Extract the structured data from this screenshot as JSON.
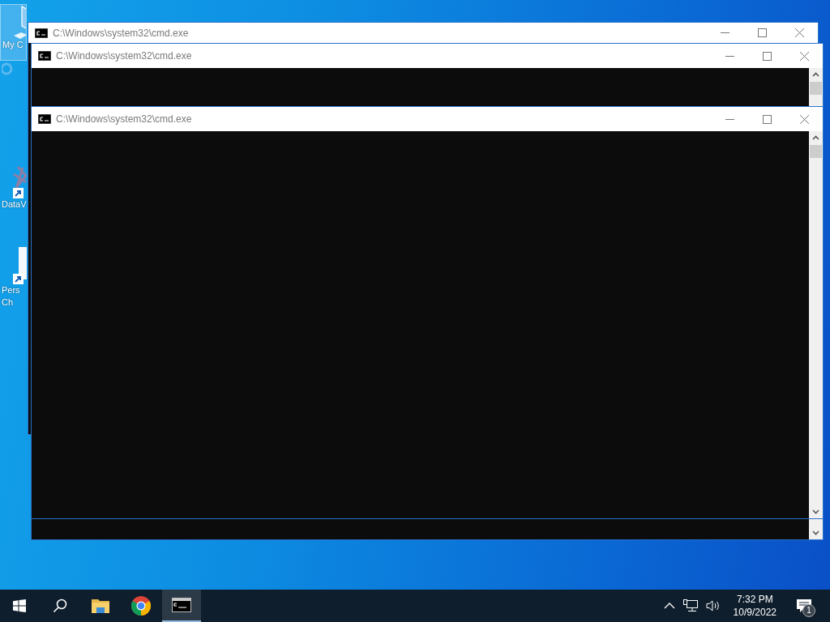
{
  "desktop_icons": [
    {
      "kind": "folder",
      "lines": [
        "My C"
      ],
      "selected": true
    },
    {
      "kind": "ring",
      "selected": false
    },
    {
      "kind": "chart",
      "lines": [
        "DataV"
      ],
      "selected": false
    },
    {
      "kind": "doc",
      "lines": [
        "Pers",
        "Ch"
      ],
      "selected": false
    }
  ],
  "windows": [
    {
      "title": "C:\\Windows\\system32\\cmd.exe"
    },
    {
      "title": "C:\\Windows\\system32\\cmd.exe"
    },
    {
      "title": "C:\\Windows\\system32\\cmd.exe"
    }
  ],
  "taskbar": {
    "apps": [
      {
        "kind": "start",
        "selected": false
      },
      {
        "kind": "search",
        "selected": false
      },
      {
        "kind": "explorer",
        "selected": false
      },
      {
        "kind": "chrome",
        "selected": false
      },
      {
        "kind": "cmd",
        "selected": true
      }
    ],
    "time": "7:32 PM",
    "date": "10/9/2022",
    "notification_count": "1"
  }
}
